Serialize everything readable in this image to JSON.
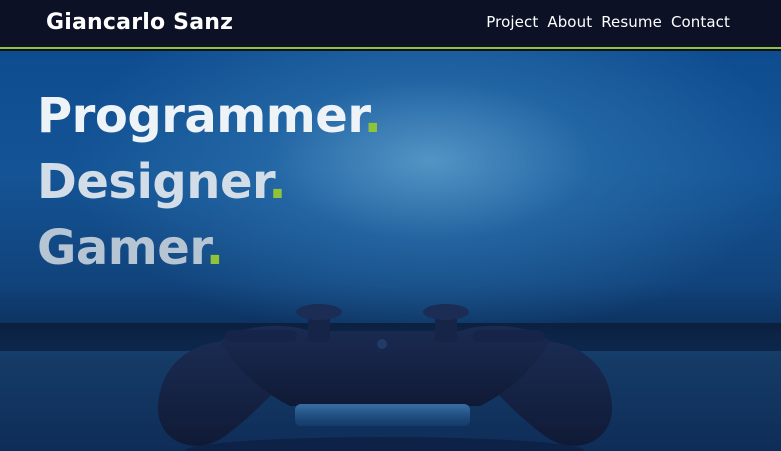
{
  "navbar": {
    "brand": "Giancarlo Sanz",
    "links": [
      "Project",
      "About",
      "Resume",
      "Contact"
    ]
  },
  "hero": {
    "lines": [
      "Programmer",
      "Designer",
      "Gamer"
    ],
    "dot": "."
  },
  "colors": {
    "navbar_bg": "#0c1126",
    "accent": "#8fc33a",
    "hero_blue": "#145496"
  }
}
